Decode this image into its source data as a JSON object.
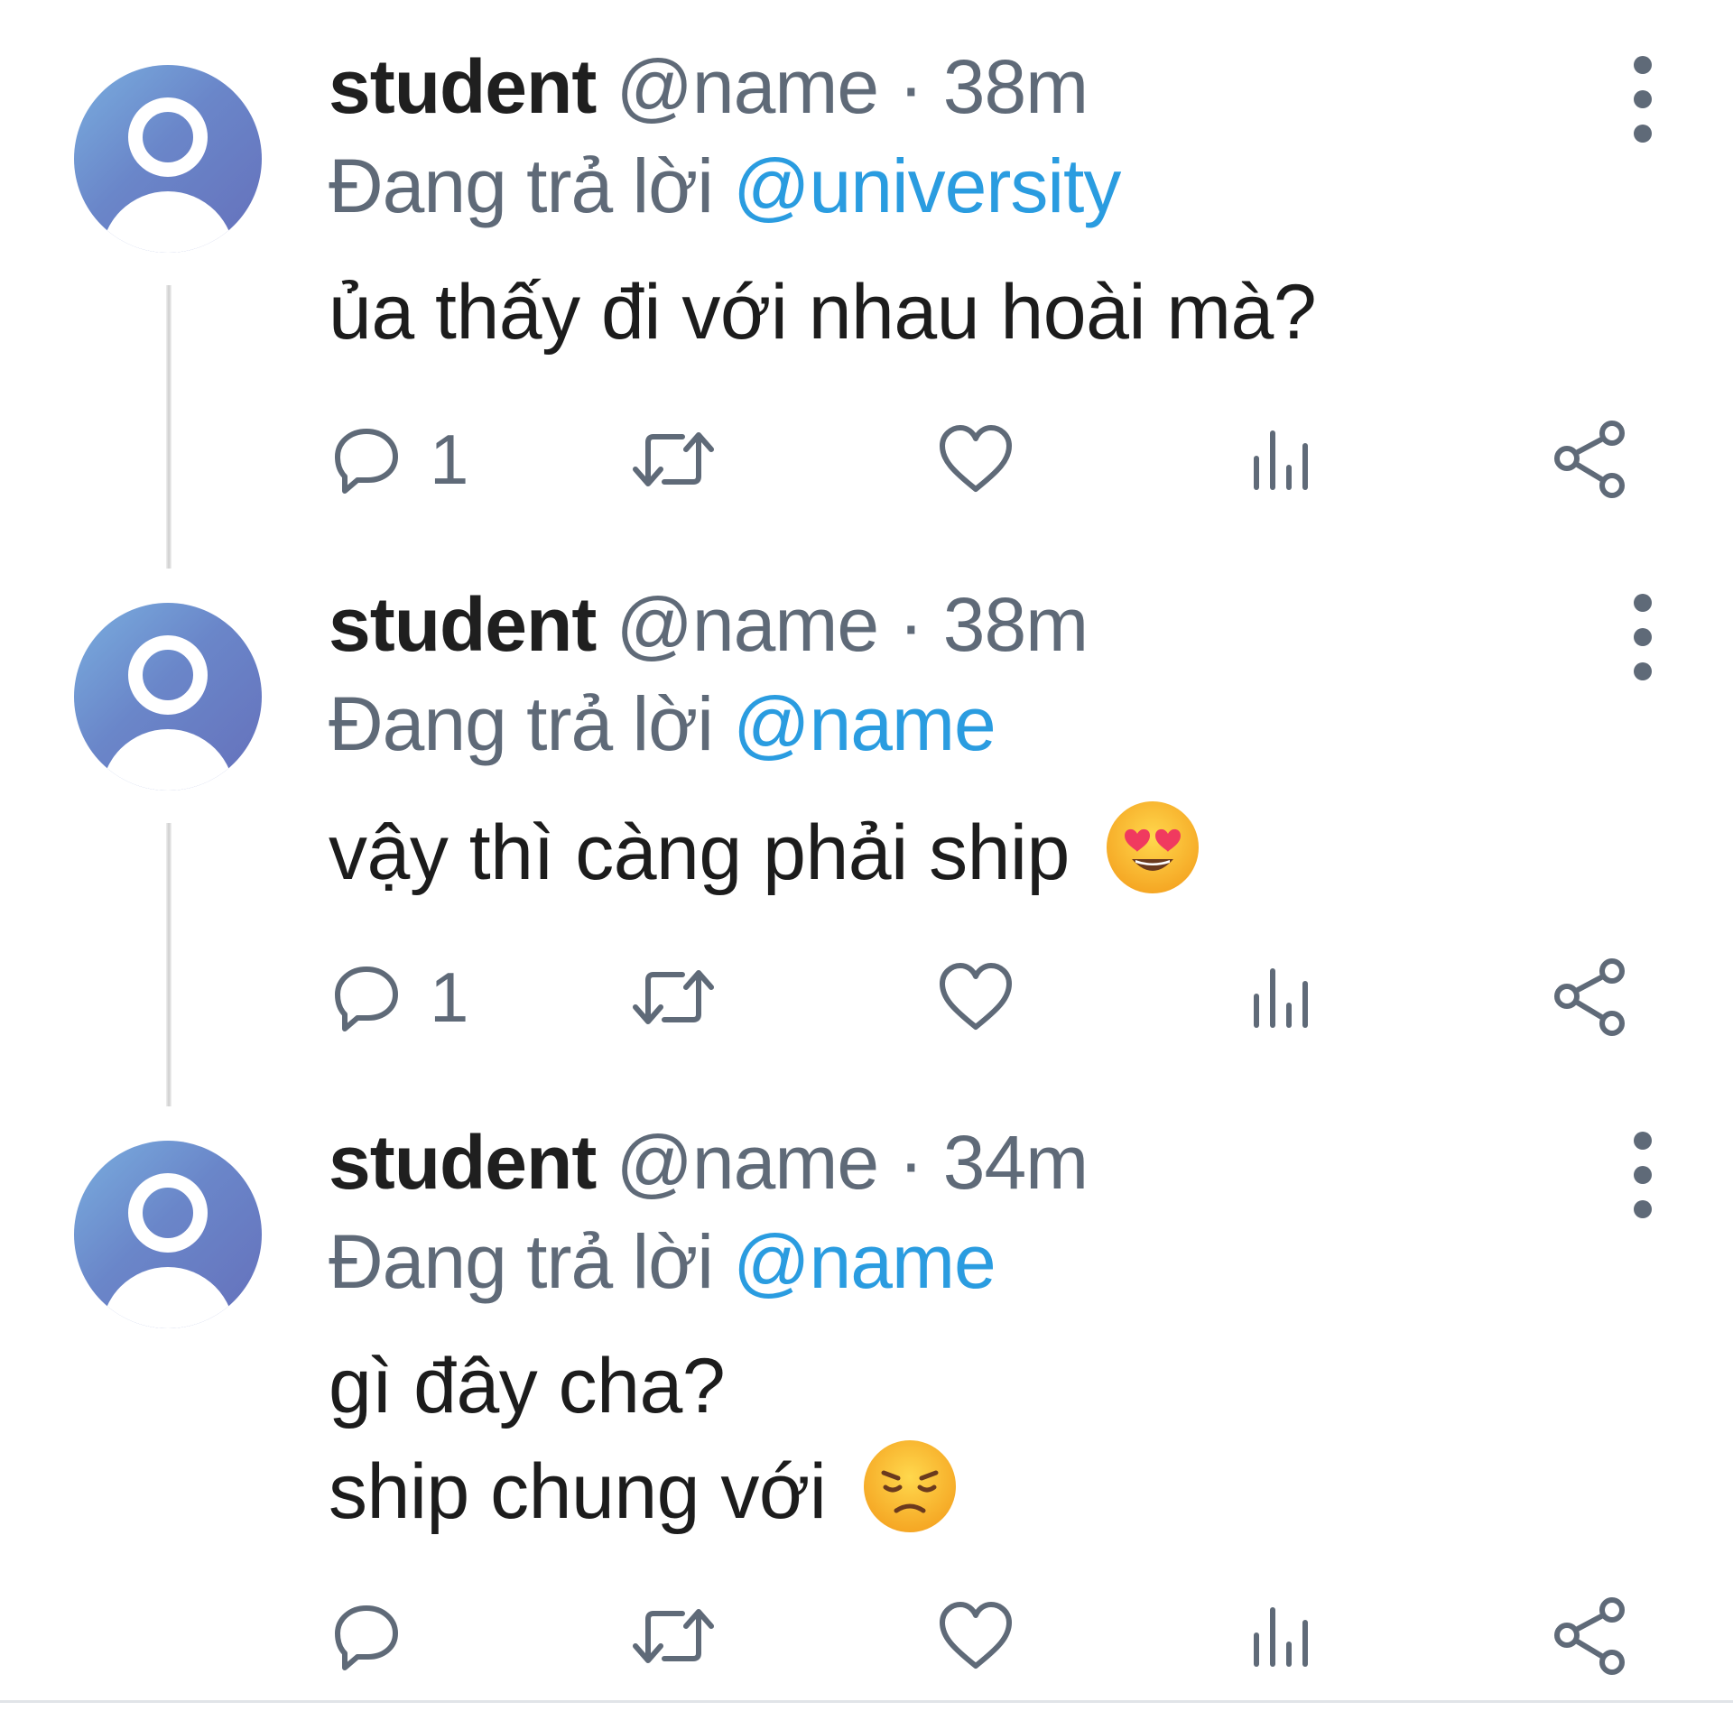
{
  "tweets": [
    {
      "display_name": "student",
      "handle": "@name",
      "dot": "·",
      "time": "38m",
      "reply_prefix": "Đang trả lời",
      "reply_to": "@university",
      "lines": [
        "ủa thấy đi với nhau hoài mà?"
      ],
      "reply_count": "1"
    },
    {
      "display_name": "student",
      "handle": "@name",
      "dot": "·",
      "time": "38m",
      "reply_prefix": "Đang trả lời",
      "reply_to": "@name",
      "lines": [
        "vậy thì càng phải ship"
      ],
      "emoji": "heart-eyes-emoji",
      "reply_count": "1"
    },
    {
      "display_name": "student",
      "handle": "@name",
      "dot": "·",
      "time": "34m",
      "reply_prefix": "Đang trả lời",
      "reply_to": "@name",
      "lines": [
        "gì đây cha?",
        "ship chung với"
      ],
      "emoji": "disappointed-face-emoji",
      "reply_count": ""
    }
  ],
  "icons": [
    "reply-icon",
    "retweet-icon",
    "like-icon",
    "views-icon",
    "share-icon",
    "more-options-icon"
  ],
  "colors": {
    "text": "#1c1c1c",
    "muted": "#5f6a78",
    "mention": "#2a9ce0"
  }
}
